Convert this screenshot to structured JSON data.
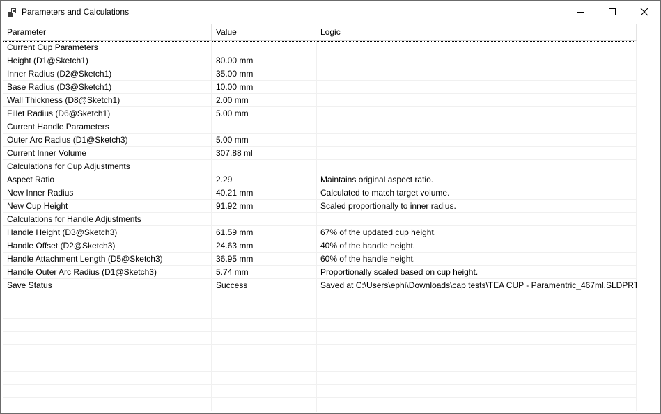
{
  "window": {
    "title": "Parameters and Calculations",
    "icon": "app-window-icon",
    "controls": {
      "minimize": "minimize-icon",
      "maximize": "maximize-icon",
      "close": "close-icon"
    }
  },
  "table": {
    "columns": [
      "Parameter",
      "Value",
      "Logic"
    ],
    "rows": [
      {
        "parameter": "Current Cup Parameters",
        "value": "",
        "logic": ""
      },
      {
        "parameter": "Height (D1@Sketch1)",
        "value": "80.00 mm",
        "logic": ""
      },
      {
        "parameter": "Inner Radius (D2@Sketch1)",
        "value": "35.00 mm",
        "logic": ""
      },
      {
        "parameter": "Base Radius (D3@Sketch1)",
        "value": "10.00 mm",
        "logic": ""
      },
      {
        "parameter": "Wall Thickness (D8@Sketch1)",
        "value": "2.00 mm",
        "logic": ""
      },
      {
        "parameter": "Fillet Radius (D6@Sketch1)",
        "value": "5.00 mm",
        "logic": ""
      },
      {
        "parameter": "Current Handle Parameters",
        "value": "",
        "logic": ""
      },
      {
        "parameter": "Outer Arc Radius (D1@Sketch3)",
        "value": "5.00 mm",
        "logic": ""
      },
      {
        "parameter": "Current Inner Volume",
        "value": "307.88 ml",
        "logic": ""
      },
      {
        "parameter": "Calculations for Cup Adjustments",
        "value": "",
        "logic": ""
      },
      {
        "parameter": "Aspect Ratio",
        "value": "2.29",
        "logic": "Maintains original aspect ratio."
      },
      {
        "parameter": "New Inner Radius",
        "value": "40.21 mm",
        "logic": "Calculated to match target volume."
      },
      {
        "parameter": "New Cup Height",
        "value": "91.92 mm",
        "logic": "Scaled proportionally to inner radius."
      },
      {
        "parameter": "Calculations for Handle Adjustments",
        "value": "",
        "logic": ""
      },
      {
        "parameter": "Handle Height (D3@Sketch3)",
        "value": "61.59 mm",
        "logic": "67% of the updated cup height."
      },
      {
        "parameter": "Handle Offset (D2@Sketch3)",
        "value": "24.63 mm",
        "logic": "40% of the handle height."
      },
      {
        "parameter": "Handle Attachment Length (D5@Sketch3)",
        "value": "36.95 mm",
        "logic": "60% of the handle height."
      },
      {
        "parameter": "Handle Outer Arc Radius (D1@Sketch3)",
        "value": "5.74 mm",
        "logic": "Proportionally scaled based on cup height."
      },
      {
        "parameter": "Save Status",
        "value": "Success",
        "logic": "Saved at C:\\Users\\ephi\\Downloads\\cap tests\\TEA CUP - Paramentric_467ml.SLDPRT"
      }
    ],
    "empty_row_count": 9,
    "selected_row": 0
  }
}
